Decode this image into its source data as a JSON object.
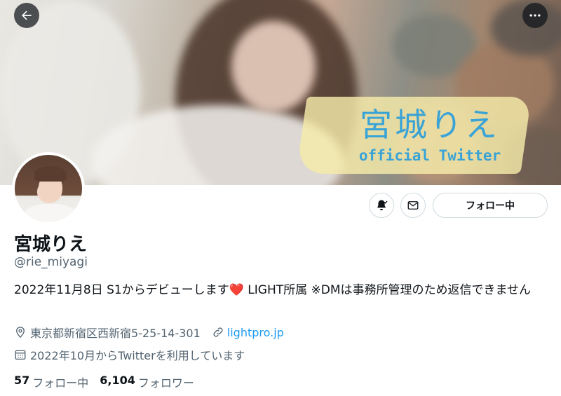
{
  "banner": {
    "title": "宮城りえ",
    "subtitle": "official Twitter"
  },
  "header": {
    "back_icon": "arrow-left-icon",
    "more_icon": "more-horizontal-icon"
  },
  "actions": {
    "notify_icon": "bell-check-icon",
    "message_icon": "envelope-icon",
    "follow_label": "フォロー中"
  },
  "profile": {
    "name": "宮城りえ",
    "handle": "@rie_miyagi",
    "bio_part1": "2022年11月8日 S1からデビューします",
    "bio_emoji": "❤️",
    "bio_part2": " LIGHT所属 ※DMは事務所管理のため返信できません",
    "location": "東京都新宿区西新宿5-25-14-301",
    "link": "lightpro.jp",
    "joined": "2022年10月からTwitterを利用しています"
  },
  "stats": {
    "following_count": "57",
    "following_label": "フォロー中",
    "followers_count": "6,104",
    "followers_label": "フォロワー"
  },
  "colors": {
    "accent": "#1d9bf0",
    "secondary_text": "#536471",
    "banner_text": "#3aa3d6"
  }
}
